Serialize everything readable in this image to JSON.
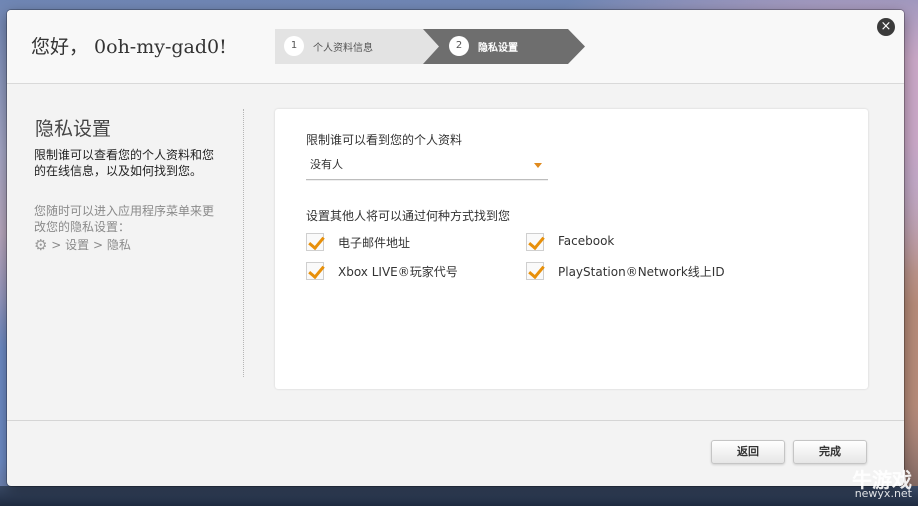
{
  "dialog": {
    "greeting": "您好， 0oh-my-gad0!",
    "close_icon": "×"
  },
  "steps": [
    {
      "number": "1",
      "label": "个人资料信息",
      "state": "done"
    },
    {
      "number": "2",
      "label": "隐私设置",
      "state": "active"
    }
  ],
  "sidebar": {
    "title": "隐私设置",
    "description": "限制谁可以查看您的个人资料和您的在线信息，以及如何找到您。",
    "note": "您随时可以进入应用程序菜单来更改您的隐私设置：",
    "path": "> 设置 > 隐私",
    "gear_icon": "gear-icon"
  },
  "panel": {
    "profile_label": "限制谁可以看到您的个人资料",
    "profile_select_value": "没有人",
    "find_label": "设置其他人将可以通过何种方式找到您",
    "options": [
      {
        "label": "电子邮件地址",
        "checked": true
      },
      {
        "label": "Facebook",
        "checked": true
      },
      {
        "label": "Xbox LIVE®玩家代号",
        "checked": true
      },
      {
        "label": "PlayStation®Network线上ID",
        "checked": true
      }
    ]
  },
  "footer": {
    "back_label": "返回",
    "done_label": "完成"
  },
  "watermark": {
    "name": "牛游戏",
    "url": "newyx.net"
  },
  "colors": {
    "accent": "#e8900a",
    "active_step": "#6e6e6e",
    "inactive_step": "#e3e3e3"
  }
}
